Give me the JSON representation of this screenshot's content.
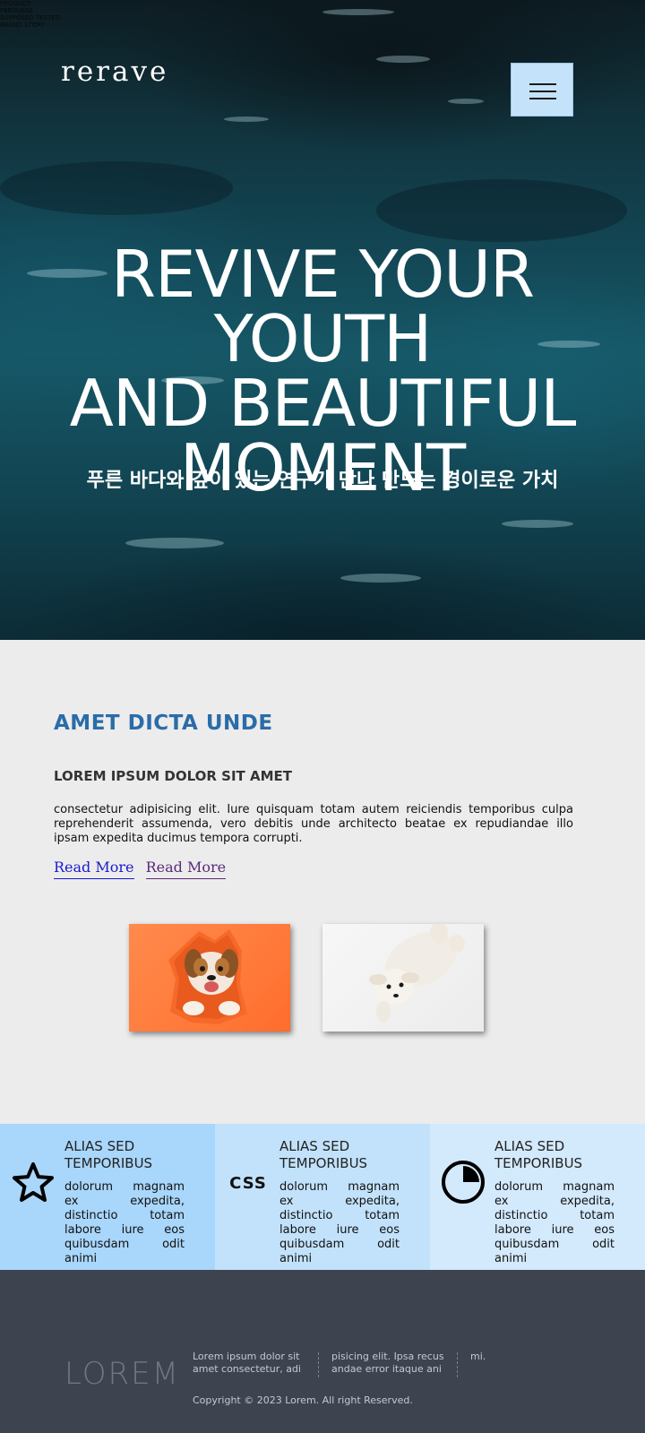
{
  "header": {
    "top_tags": [
      "PRODUCT",
      "PERSUASE",
      "SUPPOSED TESTED",
      "BRAND STORY"
    ],
    "logo": "rerave",
    "menu_icon": "hamburger-icon"
  },
  "hero": {
    "title_lines": [
      "REVIVE YOUR YOUTH",
      "AND BEAUTIFUL",
      "MOMENT"
    ],
    "subtitle": "푸른 바다와 깊이 있는 연구가 만나 만드는 경이로운 가치"
  },
  "intro": {
    "title": "AMET DICTA UNDE",
    "subtitle": "LOREM IPSUM DOLOR SIT AMET",
    "body": "consectetur adipisicing elit. Iure quisquam totam autem reiciendis temporibus culpa reprehenderit assumenda, vero debitis unde architecto beatae ex repudiandae illo ipsam expedita ducimus tempora corrupti.",
    "link1": "Read More",
    "link2": "Read More"
  },
  "features": [
    {
      "icon": "star-icon",
      "title": "ALIAS SED TEMPORIBUS",
      "text": "dolorum magnam ex expedita, distinctio totam labore iure eos quibusdam odit animi"
    },
    {
      "icon": "css-icon",
      "icon_text": "CSS",
      "title": "ALIAS SED TEMPORIBUS",
      "text": "dolorum magnam ex expedita, distinctio totam labore iure eos quibusdam odit animi"
    },
    {
      "icon": "pie-chart-icon",
      "title": "ALIAS SED TEMPORIBUS",
      "text": "dolorum magnam ex expedita, distinctio totam labore iure eos quibusdam odit animi"
    }
  ],
  "footer": {
    "logo": "LOREM",
    "col1": "Lorem ipsum dolor sit amet consectetur, adi",
    "col2": "pisicing elit. Ipsa recus andae error itaque ani",
    "col3": "mi.",
    "copyright": "Copyright © 2023 Lorem. All right Reserved."
  }
}
